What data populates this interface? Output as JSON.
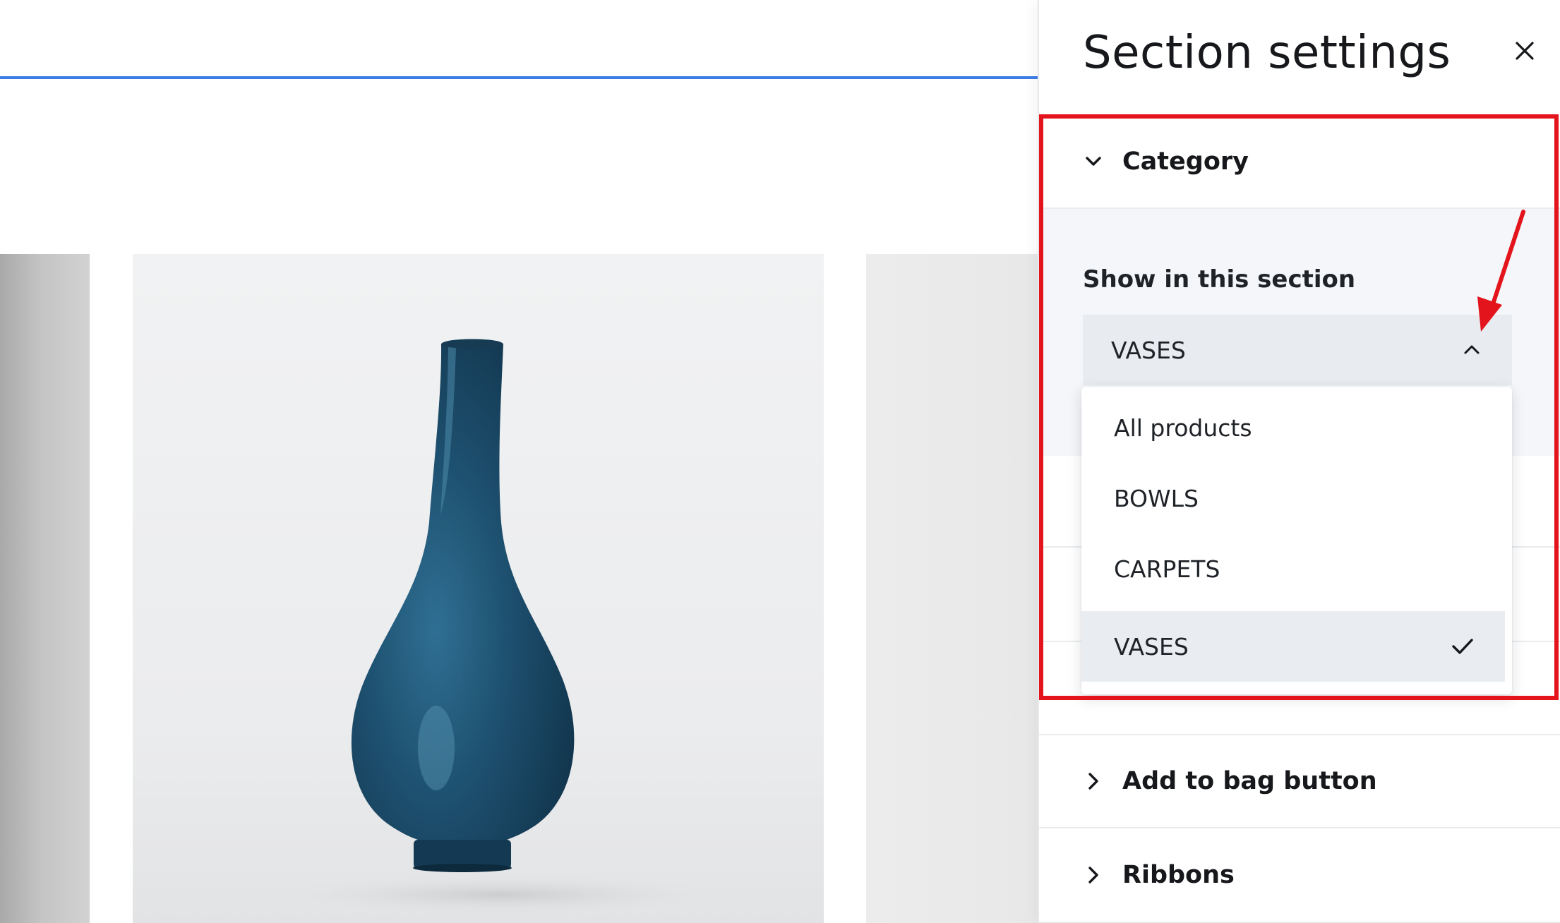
{
  "panel": {
    "title": "Section settings",
    "close_icon": "close-icon"
  },
  "category_section": {
    "title": "Category",
    "field_label": "Show in this section",
    "selected_value": "VASES",
    "options": [
      {
        "label": "All products",
        "selected": false
      },
      {
        "label": "BOWLS",
        "selected": false
      },
      {
        "label": "CARPETS",
        "selected": false
      },
      {
        "label": "VASES",
        "selected": true
      }
    ]
  },
  "sections": [
    {
      "label": "Add to bag button"
    },
    {
      "label": "Ribbons"
    }
  ],
  "colors": {
    "accent_line": "#3d7ee6",
    "annotation": "#e3141b",
    "selected_option_bg": "#e9edf1",
    "select_bg": "#e8ecf0",
    "vase": "#1d4f6e"
  },
  "canvas": {
    "product_image": "blue-vase-image"
  }
}
